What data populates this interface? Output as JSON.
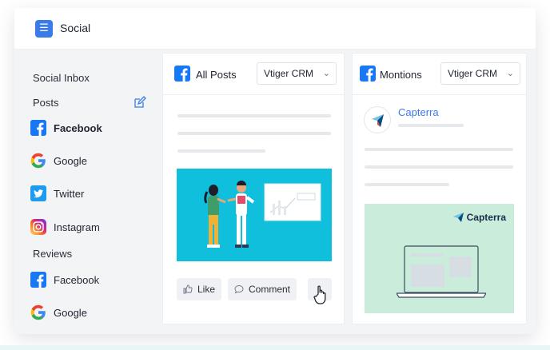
{
  "app": {
    "title": "Social",
    "menu_icon": "list-icon",
    "accent": "#3b7be8"
  },
  "sidebar": {
    "inbox_label": "Social Inbox",
    "posts_heading": "Posts",
    "posts_items": [
      {
        "label": "Facebook",
        "icon": "facebook-icon",
        "active": true
      },
      {
        "label": "Google",
        "icon": "google-icon"
      },
      {
        "label": "Twitter",
        "icon": "twitter-icon"
      },
      {
        "label": "Instagram",
        "icon": "instagram-icon"
      }
    ],
    "reviews_heading": "Reviews",
    "reviews_items": [
      {
        "label": "Facebook",
        "icon": "facebook-icon"
      },
      {
        "label": "Google",
        "icon": "google-icon"
      }
    ]
  },
  "posts_column": {
    "title": "All Posts",
    "account_select": "Vtiger CRM",
    "actions": {
      "like": "Like",
      "comment": "Comment"
    }
  },
  "mentions_column": {
    "title": "Montions",
    "account_select": "Vtiger CRM",
    "author": "Capterra",
    "brand_text": "Capterra"
  }
}
